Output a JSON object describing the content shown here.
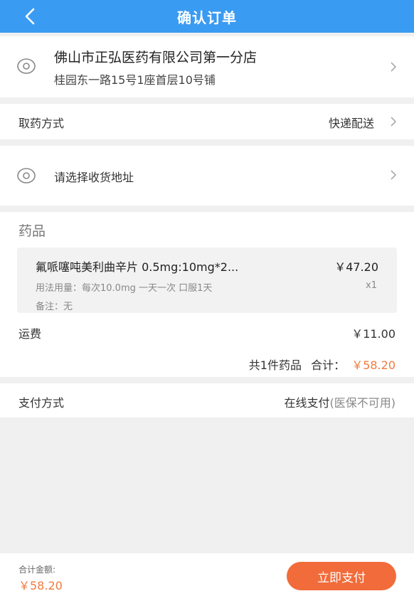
{
  "header": {
    "title": "确认订单",
    "back_icon": "chevron-left-icon"
  },
  "store": {
    "name": "佛山市正弘医药有限公司第一分店",
    "address": "桂园东一路15号1座首层10号铺",
    "icon": "location-pin-icon"
  },
  "pickup": {
    "label": "取药方式",
    "value": "快递配送"
  },
  "address": {
    "placeholder": "请选择收货地址",
    "icon": "location-pin-icon"
  },
  "medicine": {
    "section_title": "药品",
    "items": [
      {
        "name": "氟哌噻吨美利曲辛片 0.5mg:10mg*2...",
        "price": "￥47.20",
        "usage": "用法用量：每次10.0mg 一天一次 口服1天",
        "quantity": "x1",
        "note": "备注：无"
      }
    ],
    "shipping_label": "运费",
    "shipping_value": "￥11.00",
    "summary_count": "共1件药品",
    "summary_total_label": "合计：",
    "summary_total_value": "￥58.20"
  },
  "payment": {
    "label": "支付方式",
    "value": "在线支付",
    "note": "(医保不可用)"
  },
  "footer": {
    "total_label": "合计金额:",
    "total_value": "￥58.20",
    "pay_button": "立即支付"
  },
  "colors": {
    "header": "#3a9bf2",
    "accent": "#f26b3a",
    "price": "#f27a3d"
  }
}
